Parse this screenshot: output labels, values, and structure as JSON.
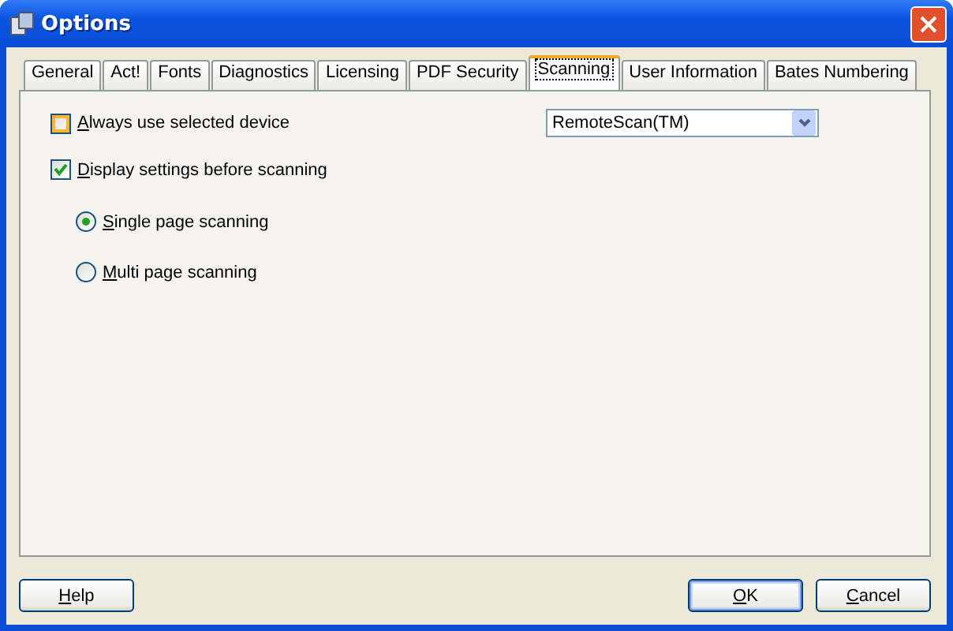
{
  "window": {
    "title": "Options"
  },
  "tabs": [
    {
      "label": "General",
      "selected": false
    },
    {
      "label": "Act!",
      "selected": false
    },
    {
      "label": "Fonts",
      "selected": false
    },
    {
      "label": "Diagnostics",
      "selected": false
    },
    {
      "label": "Licensing",
      "selected": false
    },
    {
      "label": "PDF Security",
      "selected": false
    },
    {
      "label": "Scanning",
      "selected": true
    },
    {
      "label": "User Information",
      "selected": false
    },
    {
      "label": "Bates Numbering",
      "selected": false
    }
  ],
  "always_use_device": {
    "label": "Always use selected device",
    "checked": false,
    "hot": true,
    "mnemonic": true
  },
  "device": {
    "value": "RemoteScan(TM)"
  },
  "display_settings": {
    "label": "Display settings before scanning",
    "checked": true,
    "hot": false,
    "mnemonic": true
  },
  "scan_modes": [
    {
      "label": "Single page scanning",
      "selected": true,
      "mnemonic": true
    },
    {
      "label": "Multi page scanning",
      "selected": false,
      "mnemonic": true
    }
  ],
  "buttons": [
    {
      "label": "Help",
      "kind": "left",
      "default": false,
      "mnemonic": true
    },
    {
      "label": "OK",
      "kind": "right",
      "default": true,
      "mnemonic": true
    },
    {
      "label": "Cancel",
      "kind": "right",
      "default": false,
      "mnemonic": true
    }
  ]
}
